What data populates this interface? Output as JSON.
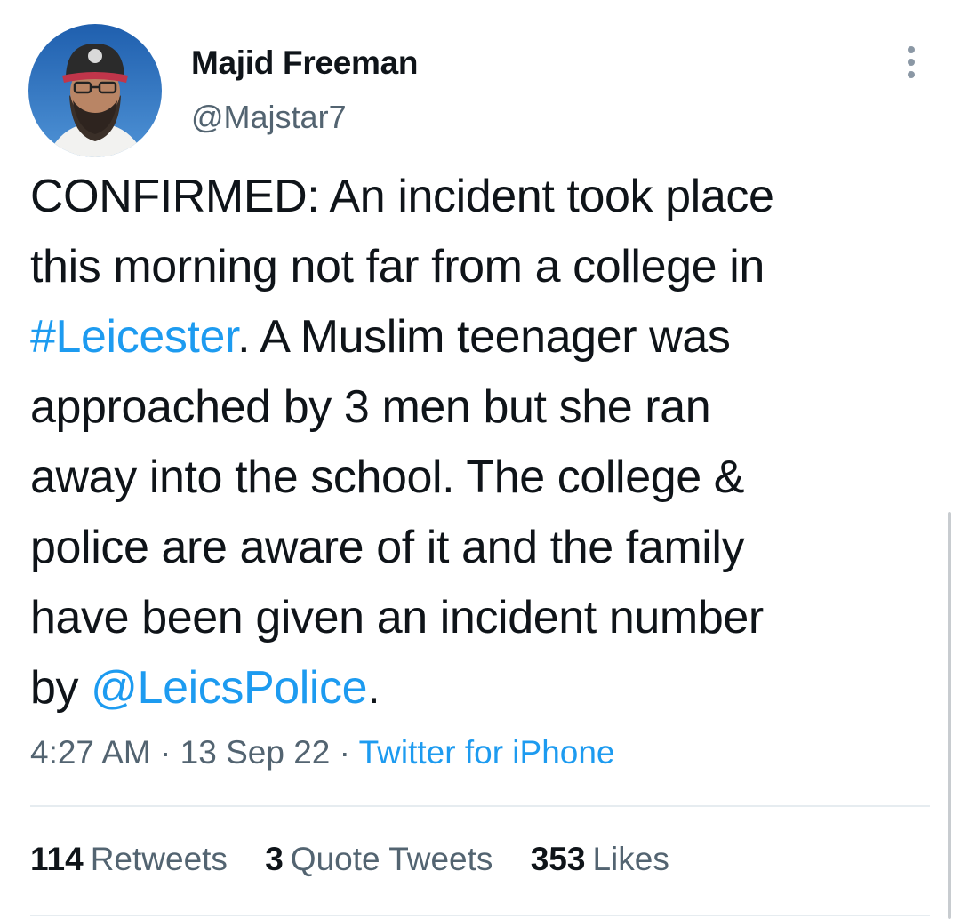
{
  "author": {
    "display_name": "Majid Freeman",
    "handle": "@Majstar7",
    "avatar_icon": "profile-photo"
  },
  "more_icon": "more-options-icon",
  "tweet": {
    "lines": [
      [
        {
          "text": "CONFIRMED: An incident took place",
          "link": false
        }
      ],
      [
        {
          "text": "this morning not far from a college in",
          "link": false
        }
      ],
      [
        {
          "text": "#Leicester",
          "link": true
        },
        {
          "text": ". A Muslim teenager was",
          "link": false
        }
      ],
      [
        {
          "text": "approached by 3 men but she ran",
          "link": false
        }
      ],
      [
        {
          "text": "away into the school. The college &",
          "link": false
        }
      ],
      [
        {
          "text": "police are aware of it and the family",
          "link": false
        }
      ],
      [
        {
          "text": "have been given an incident number",
          "link": false
        }
      ],
      [
        {
          "text": "by ",
          "link": false
        },
        {
          "text": "@LeicsPolice",
          "link": true
        },
        {
          "text": ".",
          "link": false
        }
      ]
    ]
  },
  "meta": {
    "time": "4:27 AM",
    "separator": " · ",
    "date": "13 Sep 22",
    "source": "Twitter for iPhone"
  },
  "stats": {
    "retweets_count": "114",
    "retweets_label": "Retweets",
    "quotes_count": "3",
    "quotes_label": "Quote Tweets",
    "likes_count": "353",
    "likes_label": "Likes"
  },
  "colors": {
    "link": "#1d9bf0",
    "secondary_text": "#536471",
    "primary_text": "#0f1419"
  }
}
